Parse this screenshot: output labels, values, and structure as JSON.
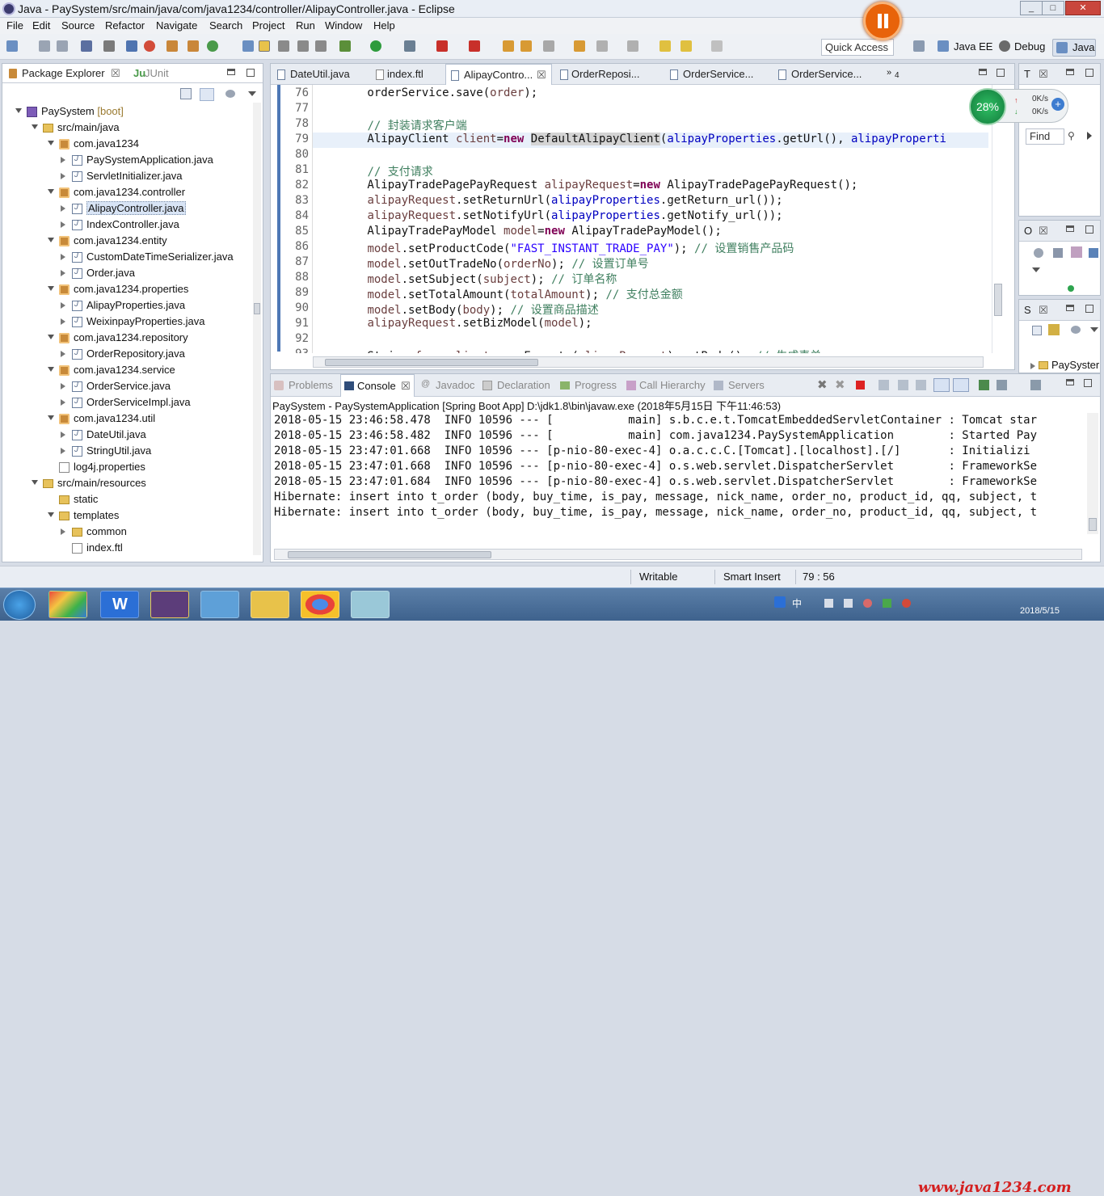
{
  "window": {
    "title": "Java - PaySystem/src/main/java/com/java1234/controller/AlipayController.java - Eclipse",
    "min": "_",
    "max": "□",
    "close": "✕"
  },
  "menu": [
    "File",
    "Edit",
    "Source",
    "Refactor",
    "Navigate",
    "Search",
    "Project",
    "Run",
    "Window",
    "Help"
  ],
  "toolbar": {
    "quick_access": "Quick Access",
    "perspectives": [
      "Java EE",
      "Debug",
      "Java"
    ]
  },
  "package_explorer": {
    "tabs": [
      "Package Explorer",
      "JUnit"
    ],
    "tree": [
      {
        "label": "PaySystem",
        "suffix": " [boot]",
        "type": "proj",
        "indent": 0,
        "tw": "open"
      },
      {
        "label": "src/main/java",
        "type": "folder",
        "indent": 1,
        "tw": "open"
      },
      {
        "label": "com.java1234",
        "type": "pkg",
        "indent": 2,
        "tw": "open"
      },
      {
        "label": "PaySystemApplication.java",
        "type": "java",
        "indent": 3,
        "tw": "closed"
      },
      {
        "label": "ServletInitializer.java",
        "type": "java",
        "indent": 3,
        "tw": "closed"
      },
      {
        "label": "com.java1234.controller",
        "type": "pkg",
        "indent": 2,
        "tw": "open"
      },
      {
        "label": "AlipayController.java",
        "type": "java",
        "indent": 3,
        "tw": "closed",
        "selected": true
      },
      {
        "label": "IndexController.java",
        "type": "java",
        "indent": 3,
        "tw": "closed"
      },
      {
        "label": "com.java1234.entity",
        "type": "pkg",
        "indent": 2,
        "tw": "open"
      },
      {
        "label": "CustomDateTimeSerializer.java",
        "type": "java",
        "indent": 3,
        "tw": "closed"
      },
      {
        "label": "Order.java",
        "type": "java",
        "indent": 3,
        "tw": "closed"
      },
      {
        "label": "com.java1234.properties",
        "type": "pkg",
        "indent": 2,
        "tw": "open"
      },
      {
        "label": "AlipayProperties.java",
        "type": "java",
        "indent": 3,
        "tw": "closed"
      },
      {
        "label": "WeixinpayProperties.java",
        "type": "java",
        "indent": 3,
        "tw": "closed"
      },
      {
        "label": "com.java1234.repository",
        "type": "pkg",
        "indent": 2,
        "tw": "open"
      },
      {
        "label": "OrderRepository.java",
        "type": "java",
        "indent": 3,
        "tw": "closed"
      },
      {
        "label": "com.java1234.service",
        "type": "pkg",
        "indent": 2,
        "tw": "open"
      },
      {
        "label": "OrderService.java",
        "type": "java",
        "indent": 3,
        "tw": "closed"
      },
      {
        "label": "OrderServiceImpl.java",
        "type": "java",
        "indent": 3,
        "tw": "closed"
      },
      {
        "label": "com.java1234.util",
        "type": "pkg",
        "indent": 2,
        "tw": "open"
      },
      {
        "label": "DateUtil.java",
        "type": "java",
        "indent": 3,
        "tw": "closed"
      },
      {
        "label": "StringUtil.java",
        "type": "java",
        "indent": 3,
        "tw": "closed"
      },
      {
        "label": "log4j.properties",
        "type": "file",
        "indent": 2,
        "tw": "none"
      },
      {
        "label": "src/main/resources",
        "type": "folder",
        "indent": 1,
        "tw": "open"
      },
      {
        "label": "static",
        "type": "folder",
        "indent": 2,
        "tw": "none"
      },
      {
        "label": "templates",
        "type": "folder",
        "indent": 2,
        "tw": "open"
      },
      {
        "label": "common",
        "type": "folder",
        "indent": 3,
        "tw": "closed"
      },
      {
        "label": "index.ftl",
        "type": "file",
        "indent": 3,
        "tw": "none"
      }
    ]
  },
  "editor": {
    "tabs": [
      "DateUtil.java",
      "index.ftl",
      "AlipayContro...",
      "OrderReposi...",
      "OrderService...",
      "OrderService...",
      "4"
    ],
    "active_tab": 2,
    "line_numbers": [
      "76",
      "77",
      "78",
      "79",
      "80",
      "81",
      "82",
      "83",
      "84",
      "85",
      "86",
      "87",
      "88",
      "89",
      "90",
      "91",
      "92",
      "93"
    ]
  },
  "console": {
    "tabs": [
      "Problems",
      "Console",
      "Javadoc",
      "Declaration",
      "Progress",
      "Call Hierarchy",
      "Servers"
    ],
    "header": "PaySystem - PaySystemApplication [Spring Boot App] D:\\jdk1.8\\bin\\javaw.exe (2018年5月15日 下午11:46:53)",
    "lines": [
      "2018-05-15 23:46:58.478  INFO 10596 --- [           main] s.b.c.e.t.TomcatEmbeddedServletContainer : Tomcat star",
      "2018-05-15 23:46:58.482  INFO 10596 --- [           main] com.java1234.PaySystemApplication        : Started Pay",
      "2018-05-15 23:47:01.668  INFO 10596 --- [p-nio-80-exec-4] o.a.c.c.C.[Tomcat].[localhost].[/]       : Initializi",
      "2018-05-15 23:47:01.668  INFO 10596 --- [p-nio-80-exec-4] o.s.web.servlet.DispatcherServlet        : FrameworkSe",
      "2018-05-15 23:47:01.684  INFO 10596 --- [p-nio-80-exec-4] o.s.web.servlet.DispatcherServlet        : FrameworkSe",
      "Hibernate: insert into t_order (body, buy_time, is_pay, message, nick_name, order_no, product_id, qq, subject, t",
      "Hibernate: insert into t_order (body, buy_time, is_pay, message, nick_name, order_no, product_id, qq, subject, t"
    ]
  },
  "side": {
    "task_tab": "T",
    "find": "Find",
    "outline_tab": "O",
    "servers_tab": "S",
    "servers_item": "PaySyster"
  },
  "net_monitor": {
    "percent": "28%",
    "up": "0K/s",
    "down": "0K/s"
  },
  "status": {
    "writable": "Writable",
    "insert": "Smart Insert",
    "position": "79 : 56"
  },
  "taskbar": {
    "ime": "中",
    "watermark": "www.java1234.com",
    "date": "2018/5/15"
  },
  "colors": {
    "keyword": "#7f0055",
    "field": "#0000c0",
    "string": "#2a00ff",
    "comment": "#3f7f5f"
  }
}
